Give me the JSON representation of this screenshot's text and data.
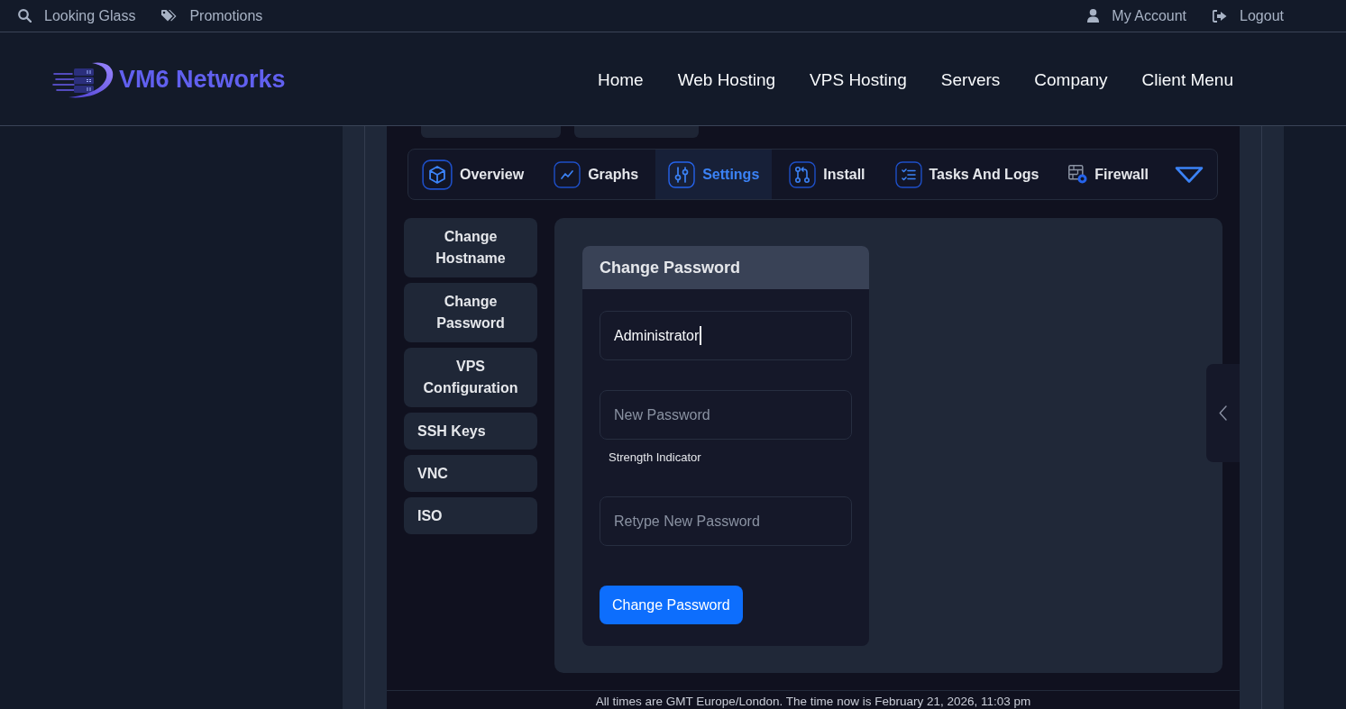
{
  "top_bar": {
    "left_links": [
      "Looking Glass",
      "Promotions"
    ],
    "right_links": [
      "My Account",
      "Logout"
    ]
  },
  "header": {
    "brand": "VM6 Networks",
    "nav": [
      "Home",
      "Web Hosting",
      "VPS Hosting",
      "Servers",
      "Company",
      "Client Menu"
    ]
  },
  "tabs": [
    {
      "label": "Overview",
      "selected": false
    },
    {
      "label": "Graphs",
      "selected": false
    },
    {
      "label": "Settings",
      "selected": true
    },
    {
      "label": "Install",
      "selected": false
    },
    {
      "label": "Tasks And Logs",
      "selected": false
    },
    {
      "label": "Firewall",
      "selected": false
    }
  ],
  "settings_menu": [
    {
      "label": "Change Hostname",
      "kind": "stacked"
    },
    {
      "label": "Change Password",
      "kind": "stacked"
    },
    {
      "label": "VPS Configuration",
      "kind": "stacked"
    },
    {
      "label": "SSH Keys",
      "kind": "plain"
    },
    {
      "label": "VNC",
      "kind": "plain"
    },
    {
      "label": "ISO",
      "kind": "plain"
    }
  ],
  "change_password": {
    "title": "Change Password",
    "username": {
      "value": "Administrator"
    },
    "new_password": {
      "placeholder": "New Password"
    },
    "strength_indicator": "Strength Indicator",
    "retype_password": {
      "placeholder": "Retype New Password"
    },
    "submit": "Change Password"
  },
  "footer": {
    "text": "All times are GMT Europe/London. The time now is February 21, 2026, 11:03 pm"
  }
}
